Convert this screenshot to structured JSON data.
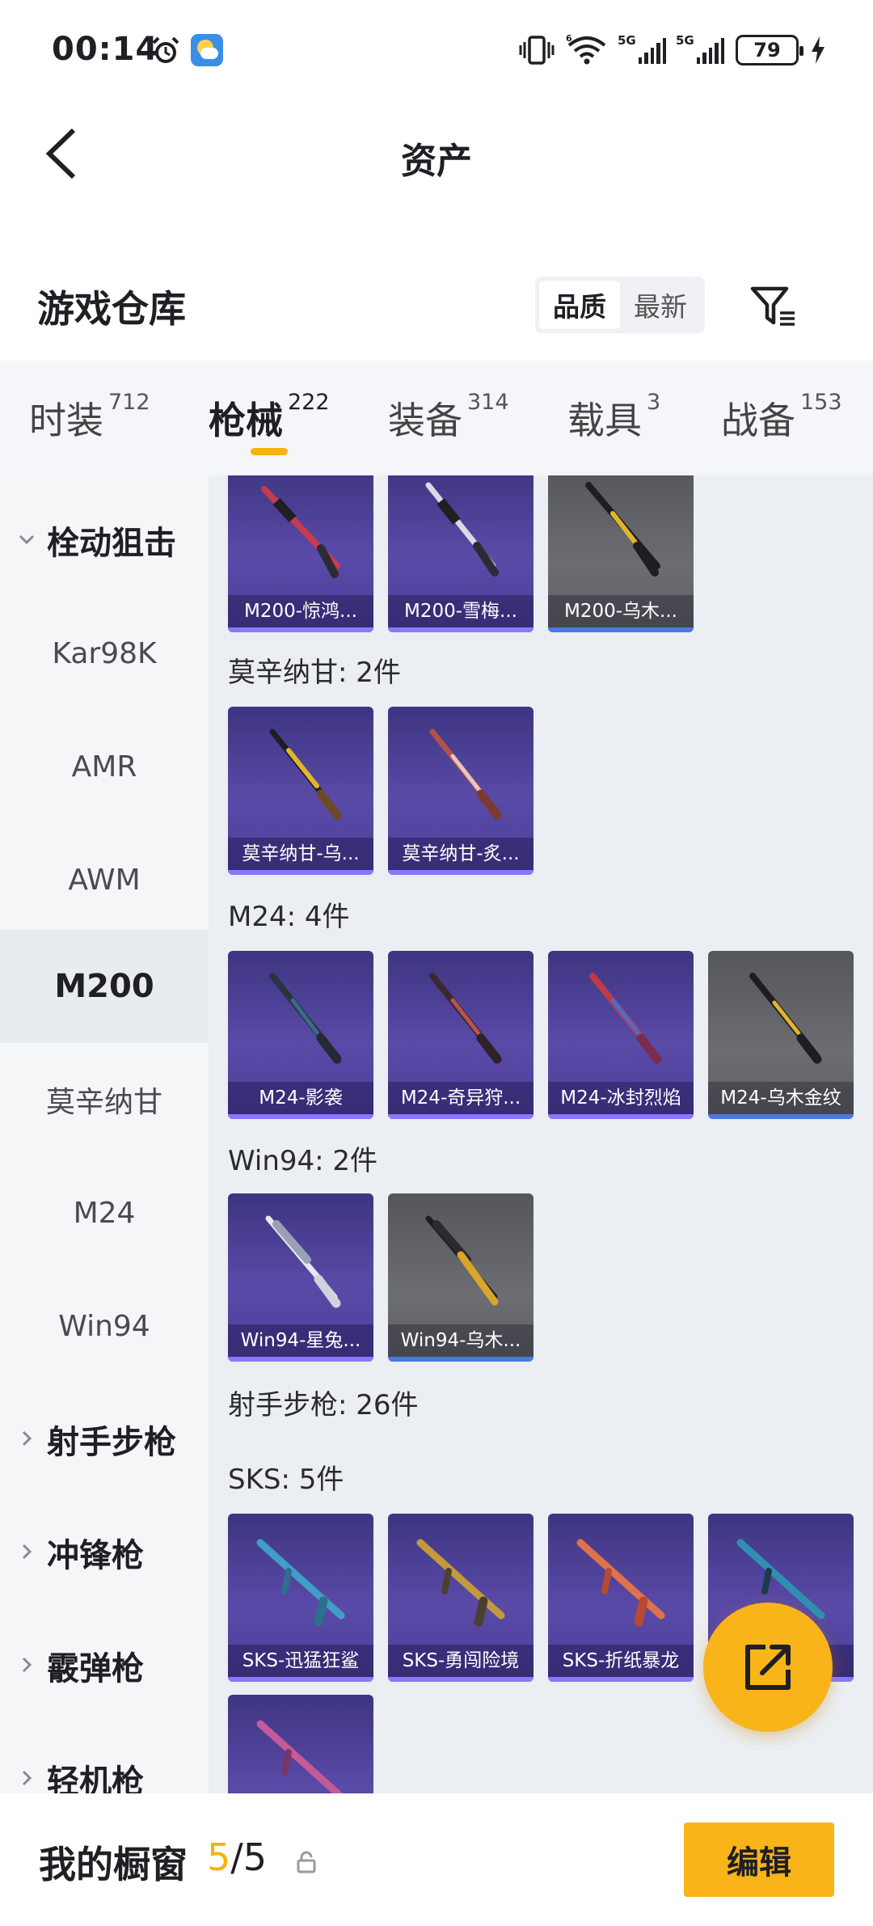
{
  "status_bar": {
    "time": "00:14",
    "battery": "79",
    "signal_labels": [
      "5G",
      "5G"
    ],
    "wifi_label": "6",
    "icons": [
      "alarm-icon",
      "weather-icon",
      "vibrate-icon",
      "wifi-icon",
      "signal-icon",
      "battery-icon",
      "charging-icon"
    ]
  },
  "header": {
    "title": "资产",
    "back_icon": "chevron-left-icon"
  },
  "warehouse": {
    "title": "游戏仓库",
    "sort_options": [
      "品质",
      "最新"
    ],
    "sort_active": "品质",
    "filter_icon": "filter-icon"
  },
  "tabs": [
    {
      "label": "时装",
      "count": "712"
    },
    {
      "label": "枪械",
      "count": "222",
      "active": true
    },
    {
      "label": "装备",
      "count": "314"
    },
    {
      "label": "载具",
      "count": "3"
    },
    {
      "label": "战备",
      "count": "153"
    }
  ],
  "sidebar": {
    "items": [
      {
        "label": "栓动狙击",
        "type": "group",
        "expanded": true
      },
      {
        "label": "Kar98K"
      },
      {
        "label": "AMR"
      },
      {
        "label": "AWM"
      },
      {
        "label": "M200",
        "active": true
      },
      {
        "label": "莫辛纳甘"
      },
      {
        "label": "M24"
      },
      {
        "label": "Win94"
      },
      {
        "label": "射手步枪",
        "type": "group"
      },
      {
        "label": "冲锋枪",
        "type": "group"
      },
      {
        "label": "霰弹枪",
        "type": "group"
      },
      {
        "label": "轻机枪",
        "type": "group"
      }
    ]
  },
  "content": {
    "sections": [
      {
        "label": "",
        "items": [
          {
            "name": "M200-惊鸿...",
            "rarity": "purple"
          },
          {
            "name": "M200-雪梅...",
            "rarity": "purple"
          },
          {
            "name": "M200-乌木...",
            "rarity": "gray"
          }
        ]
      },
      {
        "label": "莫辛纳甘: 2件",
        "items": [
          {
            "name": "莫辛纳甘-乌...",
            "rarity": "purple"
          },
          {
            "name": "莫辛纳甘-炙...",
            "rarity": "purple"
          }
        ]
      },
      {
        "label": "M24: 4件",
        "items": [
          {
            "name": "M24-影袭",
            "rarity": "purple"
          },
          {
            "name": "M24-奇异狩...",
            "rarity": "purple"
          },
          {
            "name": "M24-冰封烈焰",
            "rarity": "purple"
          },
          {
            "name": "M24-乌木金纹",
            "rarity": "gray"
          }
        ]
      },
      {
        "label": "Win94: 2件",
        "items": [
          {
            "name": "Win94-星兔...",
            "rarity": "purple"
          },
          {
            "name": "Win94-乌木...",
            "rarity": "gray"
          }
        ]
      },
      {
        "label": "射手步枪: 26件",
        "items": []
      },
      {
        "label": "SKS: 5件",
        "items": [
          {
            "name": "SKS-迅猛狂鲨",
            "rarity": "purple"
          },
          {
            "name": "SKS-勇闯险境",
            "rarity": "purple"
          },
          {
            "name": "SKS-折纸暴龙",
            "rarity": "purple"
          },
          {
            "name": "",
            "rarity": "purple"
          },
          {
            "name": "",
            "rarity": "purple"
          }
        ]
      }
    ]
  },
  "fab": {
    "icon": "share-icon"
  },
  "bottom_bar": {
    "title": "我的橱窗",
    "count_current": "5",
    "count_sep": "/",
    "count_total": "5",
    "lock_icon": "lock-icon",
    "edit_label": "编辑"
  }
}
